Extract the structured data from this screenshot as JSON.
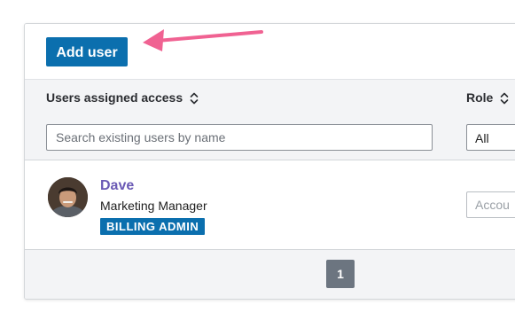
{
  "toolbar": {
    "add_user_label": "Add user"
  },
  "table": {
    "columns": [
      {
        "label": "Users assigned access"
      },
      {
        "label": "Role"
      }
    ]
  },
  "filters": {
    "search_placeholder": "Search existing users by name",
    "role_selected": "All"
  },
  "rows": [
    {
      "name": "Dave",
      "title": "Marketing Manager",
      "badge": "BILLING ADMIN",
      "account_placeholder": "Accou"
    }
  ],
  "pagination": {
    "current_page": "1"
  },
  "colors": {
    "primary": "#0b6fae",
    "link": "#6a59b5",
    "arrow": "#f06292",
    "header_bg": "#f3f4f6",
    "pager_bg": "#6c7580"
  },
  "icons": {
    "sort": "sort-icon",
    "arrow": "arrow-icon",
    "avatar": "user-avatar"
  }
}
